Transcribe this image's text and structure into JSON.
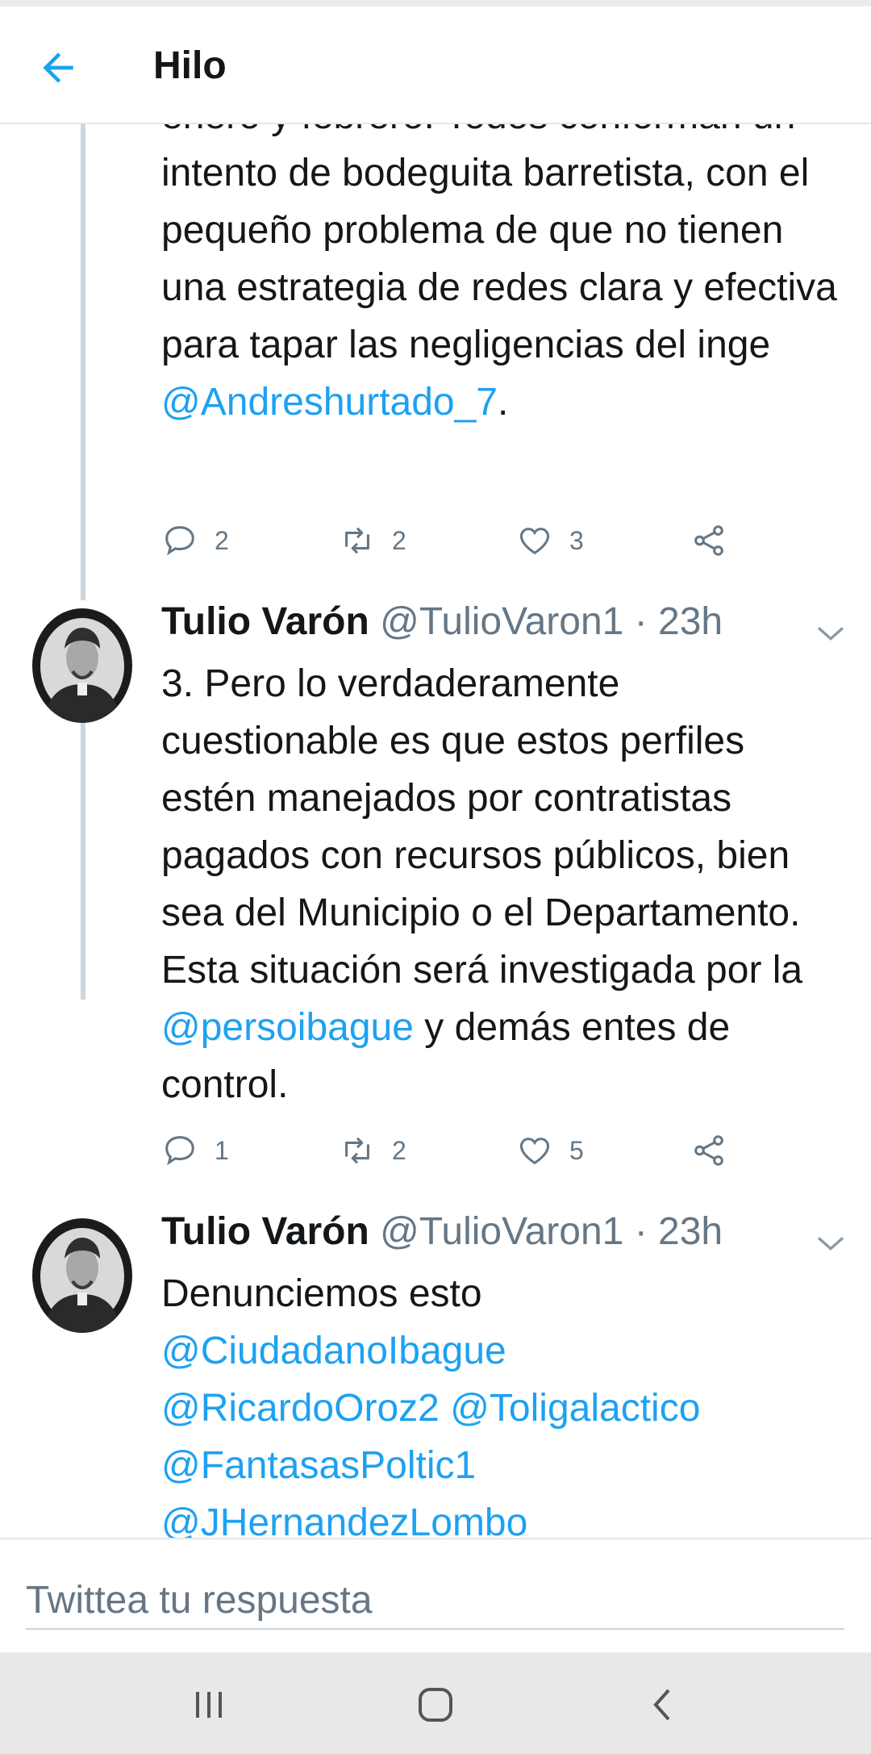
{
  "header": {
    "title": "Hilo"
  },
  "tweets": [
    {
      "text_before": "enero y febrero. Todos conforman un intento de bodeguita barretista, con el pequeño problema de que no tienen una estrategia de redes clara y efectiva para tapar las negligencias del inge",
      "mention_1": "@Andreshurtado_7",
      "text_after": ".",
      "replies": "2",
      "retweets": "2",
      "likes": "3"
    },
    {
      "name": "Tulio Varón",
      "handle": "@TulioVaron1",
      "time": "· 23h",
      "text_before": "3. Pero lo verdaderamente cuestionable es que estos perfiles estén manejados por contratistas pagados con recursos públicos, bien sea del Municipio o el Departamento. Esta situación será investigada por la",
      "mention_1": "@persoibague",
      "text_after": "y demás entes de control.",
      "replies": "1",
      "retweets": "2",
      "likes": "5"
    },
    {
      "name": "Tulio Varón",
      "handle": "@TulioVaron1",
      "time": "· 23h",
      "text_before": "Denunciemos esto",
      "mentions": [
        "@CiudadanoIbague",
        "@RicardoOroz2",
        "@Toligalactico",
        "@FantasasPoltic1",
        "@JHernandezLombo"
      ]
    }
  ],
  "reply": {
    "placeholder": "Twittea tu respuesta"
  },
  "icons": {
    "back": "arrow-left-icon",
    "reply": "speech-bubble-icon",
    "retweet": "retweet-icon",
    "like": "heart-icon",
    "share": "share-icon",
    "caret": "chevron-down-icon",
    "nav_recent": "recent-apps-icon",
    "nav_home": "home-icon",
    "nav_back": "back-icon"
  },
  "colors": {
    "accent": "#1da1f2",
    "text": "#14171a",
    "secondary": "#657786",
    "divider": "#ccd6dd"
  }
}
